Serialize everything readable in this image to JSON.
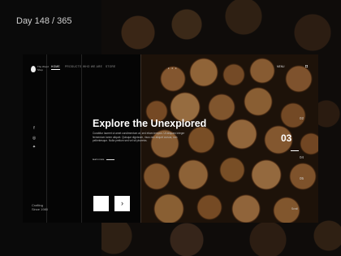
{
  "header": {
    "day_label": "Day 148 / 365"
  },
  "brand": {
    "logo_text": "The Wood Shop"
  },
  "nav": {
    "items": [
      "HOME",
      "PRODUCTS",
      "WHO WE ARE",
      "STORE"
    ]
  },
  "social": {
    "icons": [
      "facebook-icon",
      "instagram-icon",
      "twitter-icon"
    ]
  },
  "sidebar": {
    "since_line1": "Crafting",
    "since_line2": "Since 1980"
  },
  "hero": {
    "title": "Explore the Unexplored",
    "description": "Curabitur laoreet ut amet condimentum at, sed etiam tempus. Ut aliquam integer fermentum lorem aliquet. Quisque dignissim, risus nec aliquet cursus, non pellentesque. Nulla pretium sed vel sit pharetra.",
    "link_label": "learn more",
    "prev_label": "",
    "next_label": "›"
  },
  "slider": {
    "current": "03",
    "previous": "02",
    "next": "04",
    "last": "05"
  },
  "topbar": {
    "menu_label": "MENU",
    "cart_icon": "bag-icon"
  },
  "footer": {
    "label": "Scroll"
  }
}
